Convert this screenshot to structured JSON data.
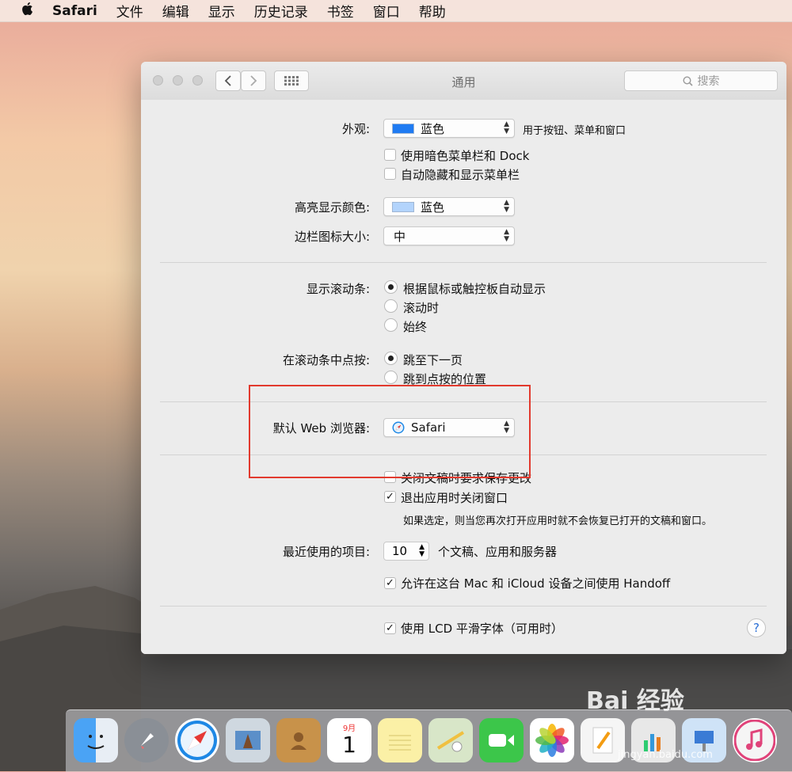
{
  "menubar": {
    "items": [
      "Safari",
      "文件",
      "编辑",
      "显示",
      "历史记录",
      "书签",
      "窗口",
      "帮助"
    ]
  },
  "window": {
    "title": "通用",
    "search_placeholder": "搜索"
  },
  "appearance": {
    "label": "外观:",
    "value": "蓝色",
    "swatch_color": "#1f7bf2",
    "hint": "用于按钮、菜单和窗口",
    "dark_menu": "使用暗色菜单栏和 Dock",
    "auto_hide": "自动隐藏和显示菜单栏"
  },
  "highlight": {
    "label": "高亮显示颜色:",
    "value": "蓝色",
    "swatch_color": "#b3d4fc"
  },
  "sidebar_size": {
    "label": "边栏图标大小:",
    "value": "中"
  },
  "scrollbars": {
    "label": "显示滚动条:",
    "options": [
      "根据鼠标或触控板自动显示",
      "滚动时",
      "始终"
    ]
  },
  "click_scroll": {
    "label": "在滚动条中点按:",
    "options": [
      "跳至下一页",
      "跳到点按的位置"
    ]
  },
  "browser": {
    "label": "默认 Web 浏览器:",
    "value": "Safari"
  },
  "documents": {
    "ask_save": "关闭文稿时要求保存更改",
    "close_windows": "退出应用时关闭窗口",
    "note": "如果选定，则当您再次打开应用时就不会恢复已打开的文稿和窗口。"
  },
  "recent": {
    "label": "最近使用的项目:",
    "value": "10",
    "suffix": "个文稿、应用和服务器"
  },
  "handoff": {
    "label": "允许在这台 Mac 和 iCloud 设备之间使用 Handoff"
  },
  "lcd": {
    "label": "使用 LCD 平滑字体（可用时）"
  },
  "help": "?",
  "dock": {
    "calendar_month": "9月",
    "calendar_day": "1"
  },
  "watermark": {
    "brand": "Bai 经验",
    "url": "jingyan.baidu.com"
  }
}
